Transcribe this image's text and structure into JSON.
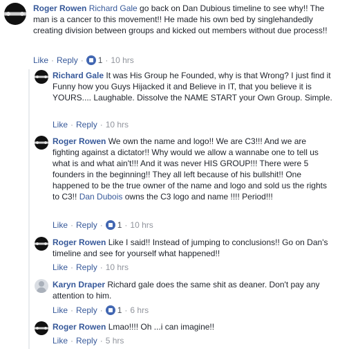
{
  "comments": [
    {
      "name": "Roger Rowen",
      "mention": "Richard Gale",
      "text": " go back on Dan Dubious timeline to see why!! The man is a cancer to this movement!! He made his own bed by singlehandedly creating division between groups and kicked out members without due process!!",
      "like": "Like",
      "reply": "Reply",
      "likes": "1",
      "time": "10 hrs"
    },
    {
      "name": "Richard Gale",
      "text": "It was His Group he Founded, why is that Wrong? I just find it Funny how you Guys Hijacked it and Believe in IT, that you believe it is YOURS.... Laughable. Dissolve the NAME START your Own Group. Simple.",
      "like": "Like",
      "reply": "Reply",
      "time": "10 hrs"
    },
    {
      "name": "Roger Rowen",
      "text": "We own the name and logo!! We are C3!!! And we are fighting against a dictator!! Why would we allow a wannabe one to tell us what is and what ain't!!! And it was never HIS GROUP!!! There were 5 founders in the beginning!! They all left because of his bullshit!! One happened to be the true owner of the name and logo and sold us the rights to C3!! ",
      "mention": "Dan Dubois",
      "text_after": " owns the C3 logo and name !!!! Period!!!",
      "like": "Like",
      "reply": "Reply",
      "likes": "1",
      "time": "10 hrs"
    },
    {
      "name": "Roger Rowen",
      "text": "Like I said!! Instead of jumping to conclusions!! Go on Dan's timeline and see for yourself what happened!!",
      "like": "Like",
      "reply": "Reply",
      "time": "10 hrs"
    },
    {
      "name": "Karyn Draper",
      "text": "Richard gale does the same shit as deaner. Don't pay any attention to him.",
      "like": "Like",
      "reply": "Reply",
      "likes": "1",
      "time": "6 hrs"
    },
    {
      "name": "Roger Rowen",
      "text": "Lmao!!!! Oh ...i can imagine!!",
      "like": "Like",
      "reply": "Reply",
      "time": "5 hrs"
    }
  ],
  "colors": {
    "link": "#365899",
    "meta": "#90949c",
    "like_badge": "#4267b2"
  },
  "icons": {
    "like": "thumbs-up-icon"
  }
}
